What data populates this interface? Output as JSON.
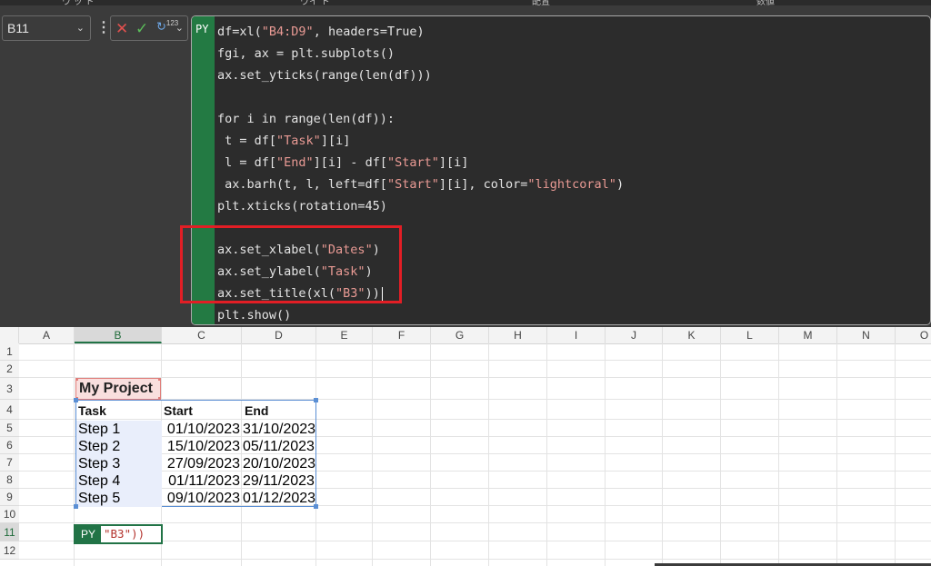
{
  "ribbon": {
    "labels": [
      "ウ ッ ト",
      "ウイ ト",
      "配置",
      "数値"
    ]
  },
  "name_box": {
    "value": "B11"
  },
  "formula_bar": {
    "python_prefix": "PY",
    "code_lines": [
      "df=xl(\"B4:D9\", headers=True)",
      "fgi, ax = plt.subplots()",
      "ax.set_yticks(range(len(df)))",
      "",
      "for i in range(len(df)):",
      " t = df[\"Task\"][i]",
      " l = df[\"End\"][i] - df[\"Start\"][i]",
      " ax.barh(t, l, left=df[\"Start\"][i], color=\"lightcoral\")",
      "plt.xticks(rotation=45)",
      "",
      "ax.set_xlabel(\"Dates\")",
      "ax.set_ylabel(\"Task\")",
      "ax.set_title(xl(\"B3\"))",
      "plt.show()"
    ]
  },
  "columns": [
    "A",
    "B",
    "C",
    "D",
    "E",
    "F",
    "G",
    "H",
    "I",
    "J",
    "K",
    "L",
    "M",
    "N",
    "O"
  ],
  "rows": [
    "1",
    "2",
    "3",
    "4",
    "5",
    "6",
    "7",
    "8",
    "9",
    "10",
    "11",
    "12"
  ],
  "sheet": {
    "title": "My Project",
    "headers": [
      "Task",
      "Start",
      "End"
    ],
    "tasks": [
      {
        "task": "Step 1",
        "start": "01/10/2023",
        "end": "31/10/2023"
      },
      {
        "task": "Step 2",
        "start": "15/10/2023",
        "end": "05/11/2023"
      },
      {
        "task": "Step 3",
        "start": "27/09/2023",
        "end": "20/10/2023"
      },
      {
        "task": "Step 4",
        "start": "01/11/2023",
        "end": "29/11/2023"
      },
      {
        "task": "Step 5",
        "start": "09/10/2023",
        "end": "01/12/2023"
      }
    ],
    "python_cell": {
      "tag": "PY",
      "text_plain": "\"B3\"))"
    }
  },
  "colors": {
    "python_green": "#217346",
    "highlight_red": "#e21e25",
    "title_fill": "#f9dfde",
    "table_border": "#5b8fd4"
  },
  "icons": [
    "cancel-icon",
    "confirm-icon",
    "python-type-icon",
    "chevron-down-icon"
  ]
}
